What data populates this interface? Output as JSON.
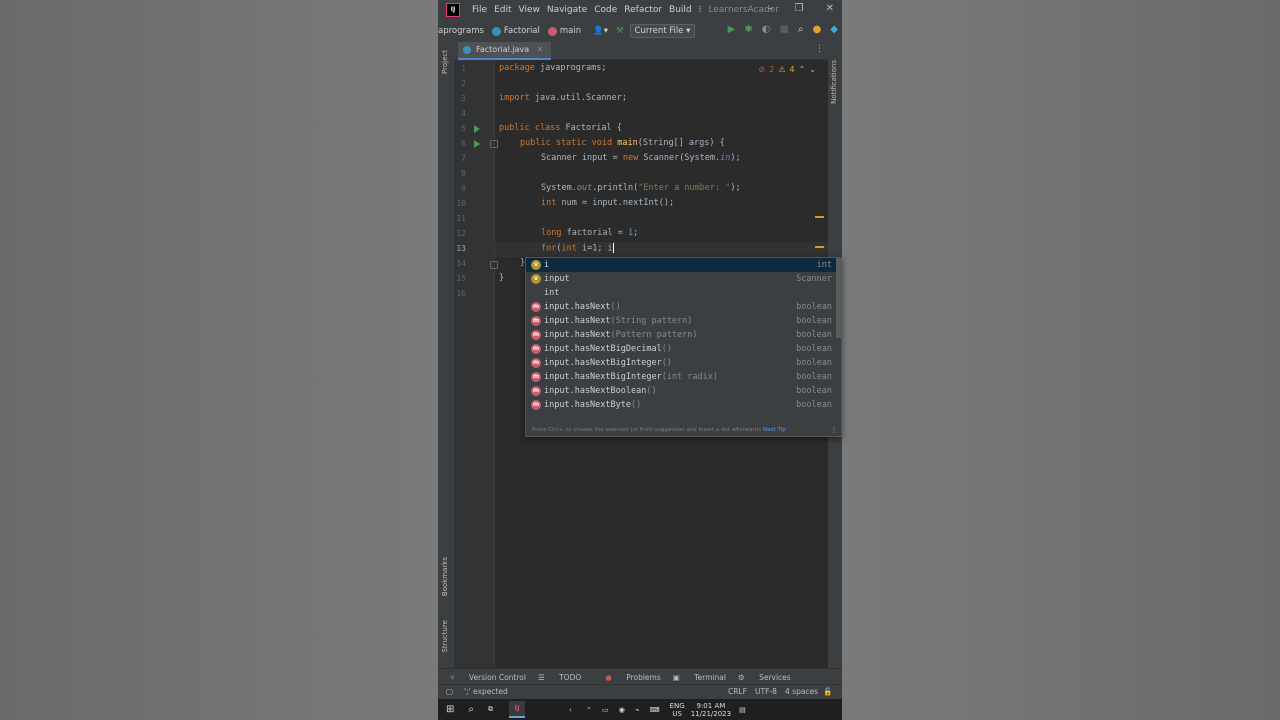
{
  "menu": {
    "items": [
      "File",
      "Edit",
      "View",
      "Navigate",
      "Code",
      "Refactor",
      "Build"
    ],
    "project": "LearnersAcader"
  },
  "toolbar": {
    "breadcrumb_package": "aprograms",
    "breadcrumb_class": "Factorial",
    "breadcrumb_method": "main",
    "run_config": "Current File"
  },
  "tab": {
    "label": "Factorial.java"
  },
  "inspections": {
    "errors": "2",
    "warnings": "4"
  },
  "side_labels": {
    "project": "Project",
    "bookmarks": "Bookmarks",
    "structure": "Structure",
    "notifications": "Notifications"
  },
  "line_numbers": [
    "1",
    "2",
    "3",
    "4",
    "5",
    "6",
    "7",
    "8",
    "9",
    "10",
    "11",
    "12",
    "13",
    "14",
    "15",
    "16"
  ],
  "code": {
    "l1_kw": "package",
    "l1_rest": " javaprograms;",
    "l3_kw": "import",
    "l3_rest": " java.util.Scanner;",
    "l5_kw": "public class",
    "l5_rest": " Factorial {",
    "l6_kw": "public static void",
    "l6_fn": "main",
    "l6_rest": "(String[] args) {",
    "l7_a": "Scanner input = ",
    "l7_kw": "new",
    "l7_b": " Scanner(System.",
    "l7_fld": "in",
    "l7_c": ");",
    "l9_a": "System.",
    "l9_fld": "out",
    "l9_b": ".println(",
    "l9_str": "\"Enter a number: \"",
    "l9_c": ");",
    "l10_kw": "int",
    "l10_var": " num",
    "l10_rest": " = input.nextInt();",
    "l12_kw": "long",
    "l12_var": " factorial",
    "l12_a": " = ",
    "l12_num": "1",
    "l12_b": ";",
    "l13_kw": "for",
    "l13_a": "(",
    "l13_kw2": "int",
    "l13_b": " i=1; i",
    "l14": "}",
    "l15": "}"
  },
  "completion": {
    "items": [
      {
        "kind": "v",
        "name": "i",
        "sig": "",
        "type": "int"
      },
      {
        "kind": "v",
        "name": "input",
        "sig": "",
        "type": "Scanner"
      },
      {
        "kind": "",
        "name": "int",
        "sig": "",
        "type": ""
      },
      {
        "kind": "m",
        "name": "input.hasNext",
        "sig": "()",
        "type": "boolean"
      },
      {
        "kind": "m",
        "name": "input.hasNext",
        "sig": "(String pattern)",
        "type": "boolean"
      },
      {
        "kind": "m",
        "name": "input.hasNext",
        "sig": "(Pattern pattern)",
        "type": "boolean"
      },
      {
        "kind": "m",
        "name": "input.hasNextBigDecimal",
        "sig": "()",
        "type": "boolean"
      },
      {
        "kind": "m",
        "name": "input.hasNextBigInteger",
        "sig": "()",
        "type": "boolean"
      },
      {
        "kind": "m",
        "name": "input.hasNextBigInteger",
        "sig": "(int radix)",
        "type": "boolean"
      },
      {
        "kind": "m",
        "name": "input.hasNextBoolean",
        "sig": "()",
        "type": "boolean"
      },
      {
        "kind": "m",
        "name": "input.hasNextByte",
        "sig": "()",
        "type": "boolean"
      }
    ],
    "hint": "Press Ctrl+. to choose the selected (or first) suggestion and insert a dot afterwards",
    "next_tip": "Next Tip"
  },
  "bottom_tools": [
    "Version Control",
    "TODO",
    "Problems",
    "Terminal",
    "Services"
  ],
  "status": {
    "message": "';' expected",
    "line_sep": "CRLF",
    "encoding": "UTF-8",
    "indent": "4 spaces"
  },
  "taskbar": {
    "lang": "ENG",
    "region": "US",
    "time": "9:01 AM",
    "date": "11/21/2023"
  },
  "colors": {
    "keyword": "#cc7832",
    "function": "#ffc66d",
    "string": "#6a8759",
    "number": "#6897bb",
    "field": "#9876aa",
    "selection": "#0d293e"
  }
}
